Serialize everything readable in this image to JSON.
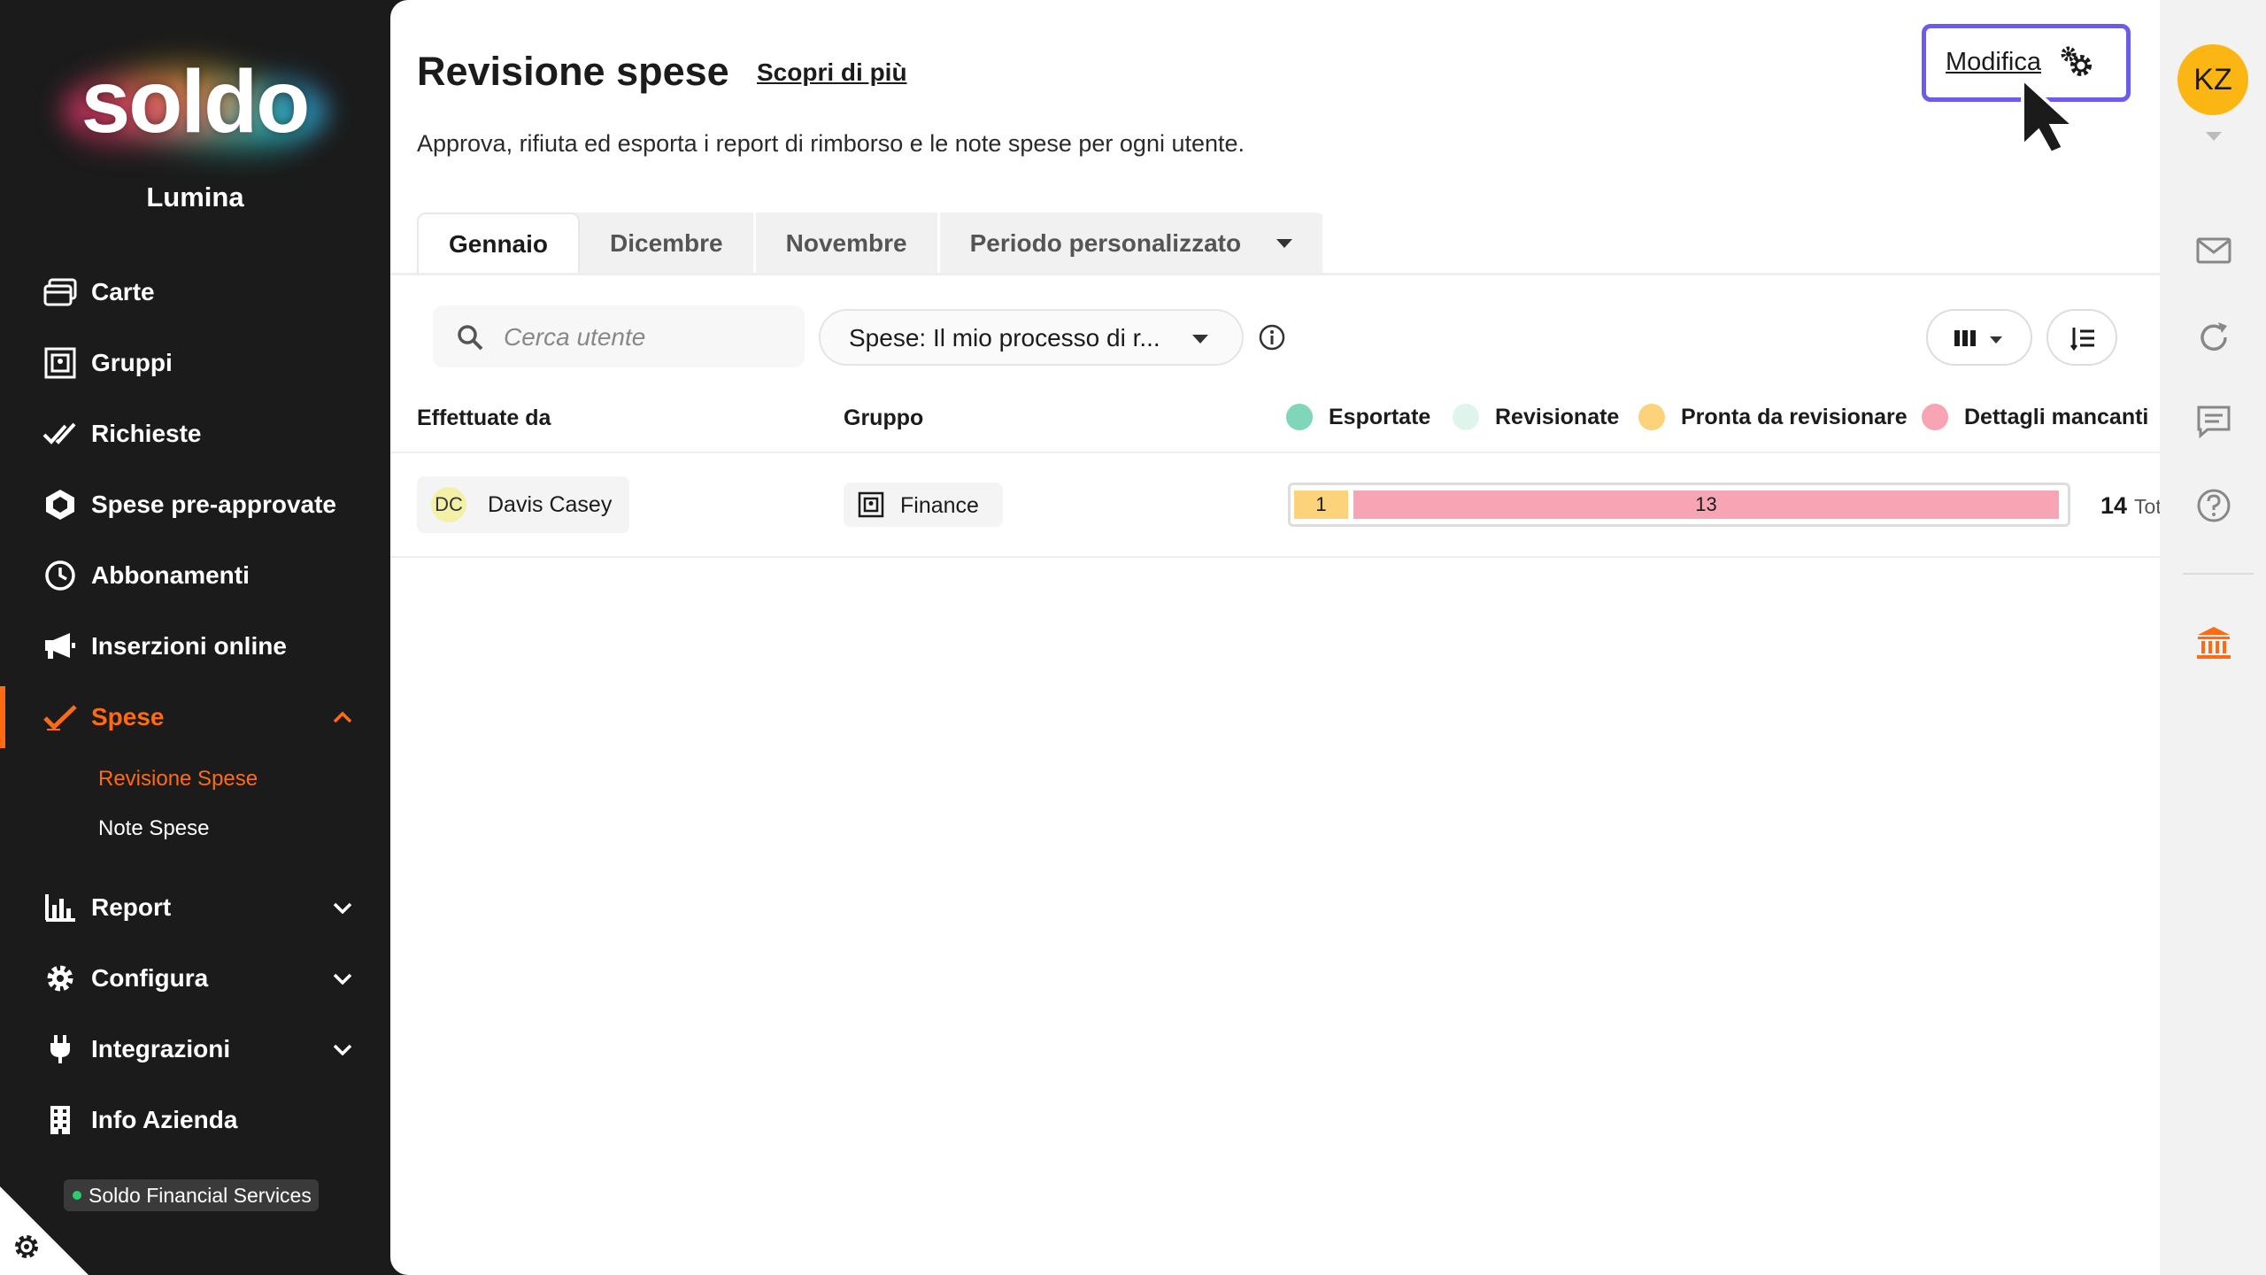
{
  "sidebar": {
    "logo": "soldo",
    "org_name": "Lumina",
    "items": [
      {
        "label": "Carte",
        "icon": "cards-icon"
      },
      {
        "label": "Gruppi",
        "icon": "groups-icon"
      },
      {
        "label": "Richieste",
        "icon": "double-check-icon"
      },
      {
        "label": "Spese pre-approvate",
        "icon": "hexagon-badge-icon"
      },
      {
        "label": "Abbonamenti",
        "icon": "clock-icon"
      },
      {
        "label": "Inserzioni online",
        "icon": "megaphone-icon"
      },
      {
        "label": "Spese",
        "icon": "check-icon",
        "active": true,
        "expanded": true
      },
      {
        "label": "Report",
        "icon": "bar-chart-icon"
      },
      {
        "label": "Configura",
        "icon": "gear-icon"
      },
      {
        "label": "Integrazioni",
        "icon": "plug-icon"
      },
      {
        "label": "Info Azienda",
        "icon": "building-icon"
      }
    ],
    "sub_items": [
      {
        "label": "Revisione Spese",
        "active": true
      },
      {
        "label": "Note Spese",
        "active": false
      }
    ],
    "company_badge": "Soldo Financial Services"
  },
  "main": {
    "title": "Revisione spese",
    "learn_more": "Scopri di più",
    "subtitle": "Approva, rifiuta ed esporta i report di rimborso e le note spese per ogni utente.",
    "edit_label": "Modifica",
    "tabs": [
      {
        "label": "Gennaio",
        "active": true
      },
      {
        "label": "Dicembre"
      },
      {
        "label": "Novembre"
      },
      {
        "label": "Periodo personalizzato",
        "dropdown": true
      }
    ],
    "search_placeholder": "Cerca utente",
    "filter_value": "Spese: Il mio processo di r...",
    "columns": {
      "user": "Effettuate da",
      "group": "Gruppo"
    },
    "legend": [
      {
        "label": "Esportate",
        "color": "#7fd6b8"
      },
      {
        "label": "Revisionate",
        "color": "#dff5ec"
      },
      {
        "label": "Pronta da revisionare",
        "color": "#fcd27a"
      },
      {
        "label": "Dettagli mancanti",
        "color": "#f7a5b5"
      }
    ],
    "rows": [
      {
        "initials": "DC",
        "user": "Davis Casey",
        "group": "Finance",
        "segments": [
          {
            "label": "1",
            "value": 1,
            "color": "#fcd27a"
          },
          {
            "label": "13",
            "value": 13,
            "color": "#f7a5b5"
          }
        ],
        "total": "14",
        "total_unit": "Tot"
      }
    ]
  },
  "rail": {
    "avatar_initials": "KZ",
    "avatar_color": "#fcb614",
    "icons": [
      "mail-icon",
      "refresh-icon",
      "chat-icon",
      "help-icon",
      "bank-icon"
    ],
    "accent": "#ff6a13"
  }
}
